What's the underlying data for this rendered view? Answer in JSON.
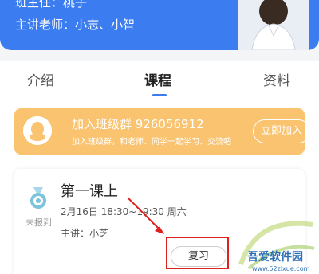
{
  "header": {
    "class_teacher": "班主任：桃子",
    "lecturers": "主讲老师：小志、小智"
  },
  "tabs": [
    {
      "label": "介绍",
      "active": false
    },
    {
      "label": "课程",
      "active": true
    },
    {
      "label": "资料",
      "active": false
    }
  ],
  "group": {
    "title": "加入班级群 926056912",
    "subtitle": "加入班级群，和老师、同学一起学习、交流吧",
    "join_label": "立即加入"
  },
  "lesson": {
    "status": "未报到",
    "title": "第一课上",
    "time": "2月16日 18:30~19:30 周六",
    "teacher": "主讲：小芝",
    "review_label": "复习"
  },
  "watermark": {
    "text": "吾爱软件园",
    "url": "www.52zixue.com"
  },
  "colors": {
    "banner": "#3b7df0",
    "group_card": "#f9c36f",
    "highlight": "#e0201c"
  }
}
